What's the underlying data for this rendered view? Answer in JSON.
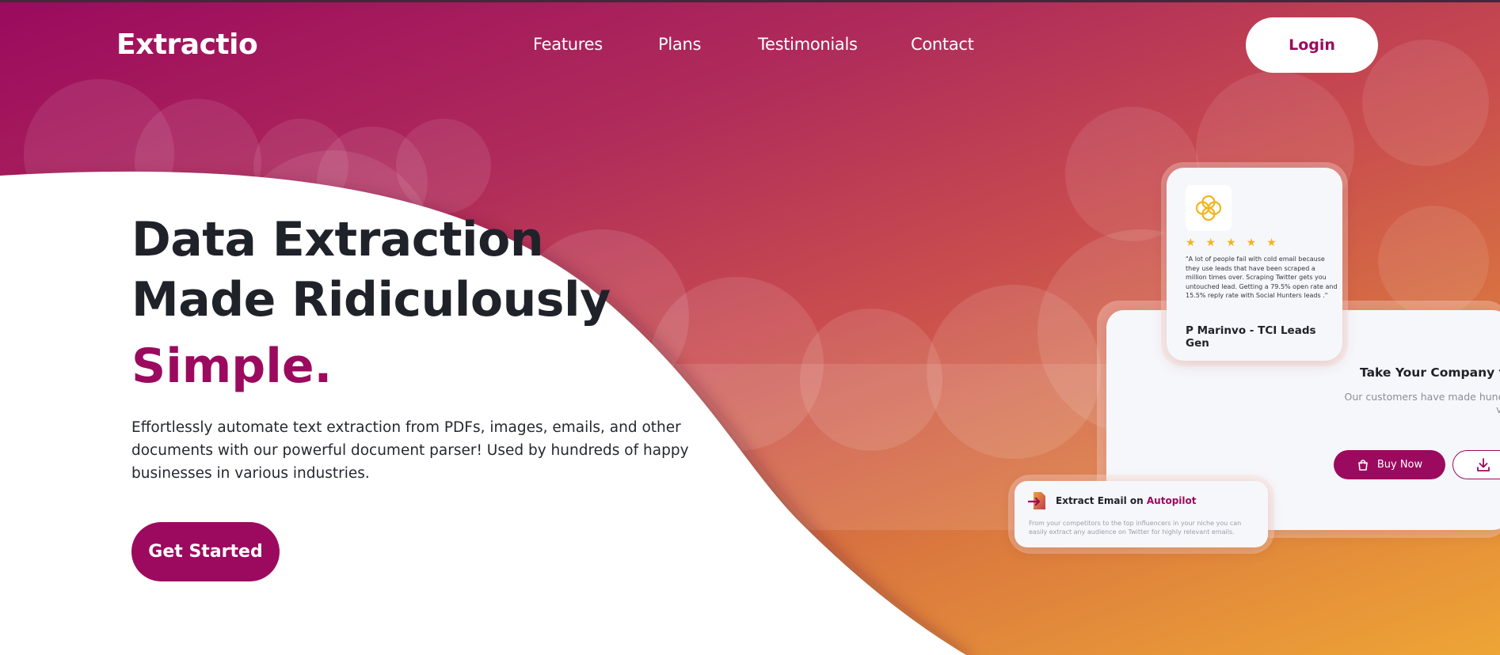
{
  "brand": "Extractio",
  "nav": {
    "links": [
      "Features",
      "Plans",
      "Testimonials",
      "Contact"
    ],
    "login_label": "Login"
  },
  "hero": {
    "headline_line1": "Data Extraction",
    "headline_line2": "Made Ridiculously",
    "headline_accent": "Simple.",
    "description": "Effortlessly automate text extraction from PDFs, images, emails, and other documents with our powerful document parser! Used by hundreds of happy businesses in various industries.",
    "cta_label": "Get Started"
  },
  "testimonial_card": {
    "rating": 5,
    "stars": "★★★★★",
    "quote": "\"A lot of people fail with cold email because they use leads that have been scraped a million times over. Scraping Twitter gets you untouched lead. Getting a 79.5% open rate and 15.5% reply rate with Social Hunters leads .\"",
    "author": "P Marinvo - TCI Leads Gen"
  },
  "company_card": {
    "title": "Take Your Company to",
    "text": "Our customers have made hundreds of tho verified lead",
    "buy_label": "Buy Now",
    "download_icon": "download-icon",
    "bag_icon": "shopping-bag-icon"
  },
  "email_card": {
    "title_prefix": "Extract Email on ",
    "title_accent": "Autopilot",
    "text": "From your competitors to the top influencers in your niche you can easily extract any audience on Twitter for highly relevant emails."
  },
  "colors": {
    "brand": "#9b0a5e",
    "gradient_start": "#9b0a5e",
    "gradient_end": "#eea535",
    "star": "#f1b51c",
    "heading": "#20222a"
  }
}
